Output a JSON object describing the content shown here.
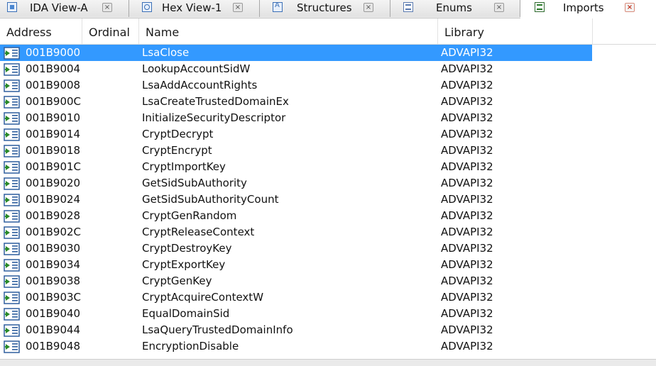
{
  "tabs": [
    {
      "label": "IDA View-A",
      "icon": "ida-view-icon"
    },
    {
      "label": "Hex View-1",
      "icon": "hex-view-icon"
    },
    {
      "label": "Structures",
      "icon": "structures-icon"
    },
    {
      "label": "Enums",
      "icon": "enums-icon"
    },
    {
      "label": "Imports",
      "icon": "imports-icon",
      "active": true
    }
  ],
  "close_glyph": "×",
  "table": {
    "columns": [
      "Address",
      "Ordinal",
      "Name",
      "Library"
    ],
    "rows": [
      {
        "address": "001B9000",
        "ordinal": "",
        "name": "LsaClose",
        "library": "ADVAPI32",
        "selected": true
      },
      {
        "address": "001B9004",
        "ordinal": "",
        "name": "LookupAccountSidW",
        "library": "ADVAPI32"
      },
      {
        "address": "001B9008",
        "ordinal": "",
        "name": "LsaAddAccountRights",
        "library": "ADVAPI32"
      },
      {
        "address": "001B900C",
        "ordinal": "",
        "name": "LsaCreateTrustedDomainEx",
        "library": "ADVAPI32"
      },
      {
        "address": "001B9010",
        "ordinal": "",
        "name": "InitializeSecurityDescriptor",
        "library": "ADVAPI32"
      },
      {
        "address": "001B9014",
        "ordinal": "",
        "name": "CryptDecrypt",
        "library": "ADVAPI32"
      },
      {
        "address": "001B9018",
        "ordinal": "",
        "name": "CryptEncrypt",
        "library": "ADVAPI32"
      },
      {
        "address": "001B901C",
        "ordinal": "",
        "name": "CryptImportKey",
        "library": "ADVAPI32"
      },
      {
        "address": "001B9020",
        "ordinal": "",
        "name": "GetSidSubAuthority",
        "library": "ADVAPI32"
      },
      {
        "address": "001B9024",
        "ordinal": "",
        "name": "GetSidSubAuthorityCount",
        "library": "ADVAPI32"
      },
      {
        "address": "001B9028",
        "ordinal": "",
        "name": "CryptGenRandom",
        "library": "ADVAPI32"
      },
      {
        "address": "001B902C",
        "ordinal": "",
        "name": "CryptReleaseContext",
        "library": "ADVAPI32"
      },
      {
        "address": "001B9030",
        "ordinal": "",
        "name": "CryptDestroyKey",
        "library": "ADVAPI32"
      },
      {
        "address": "001B9034",
        "ordinal": "",
        "name": "CryptExportKey",
        "library": "ADVAPI32"
      },
      {
        "address": "001B9038",
        "ordinal": "",
        "name": "CryptGenKey",
        "library": "ADVAPI32"
      },
      {
        "address": "001B903C",
        "ordinal": "",
        "name": "CryptAcquireContextW",
        "library": "ADVAPI32"
      },
      {
        "address": "001B9040",
        "ordinal": "",
        "name": "EqualDomainSid",
        "library": "ADVAPI32"
      },
      {
        "address": "001B9044",
        "ordinal": "",
        "name": "LsaQueryTrustedDomainInfo",
        "library": "ADVAPI32"
      },
      {
        "address": "001B9048",
        "ordinal": "",
        "name": "EncryptionDisable",
        "library": "ADVAPI32"
      }
    ]
  },
  "colors": {
    "selection": "#3399ff",
    "import_icon_frame": "#2f5f9e",
    "import_icon_arrow": "#2a8a2a"
  }
}
